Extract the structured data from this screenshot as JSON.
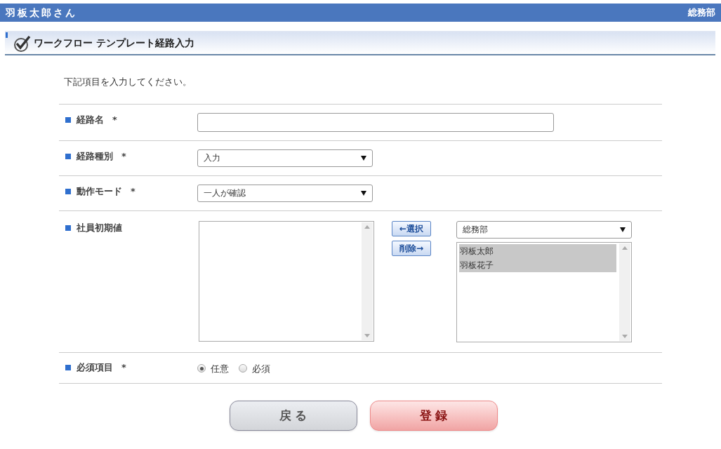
{
  "header": {
    "user": "羽板太郎さん",
    "department": "総務部"
  },
  "page_title": "ワークフロー テンプレート経路入力",
  "instruction": "下記項目を入力してください。",
  "fields": [
    {
      "kind": "text",
      "label": "経路名",
      "required_mark": "*"
    },
    {
      "kind": "select",
      "label": "経路種別",
      "required_mark": "*",
      "value": "入力"
    },
    {
      "kind": "select",
      "label": "動作モード",
      "required_mark": "*",
      "value": "一人が確認"
    },
    {
      "kind": "transfer",
      "label": "社員初期値",
      "add_button": "←選択",
      "remove_button": "削除→",
      "group_value": "総務部",
      "candidates": [
        {
          "name": "羽板太郎",
          "selected": true
        },
        {
          "name": "羽板花子",
          "selected": true
        }
      ]
    },
    {
      "kind": "radio",
      "label": "必須項目",
      "required_mark": "*",
      "options": [
        {
          "label": "任意",
          "selected": true
        },
        {
          "label": "必須",
          "selected": false
        }
      ]
    }
  ],
  "buttons": [
    {
      "kind": "secondary",
      "label": "戻 る"
    },
    {
      "kind": "primary",
      "label": "登 録"
    }
  ]
}
